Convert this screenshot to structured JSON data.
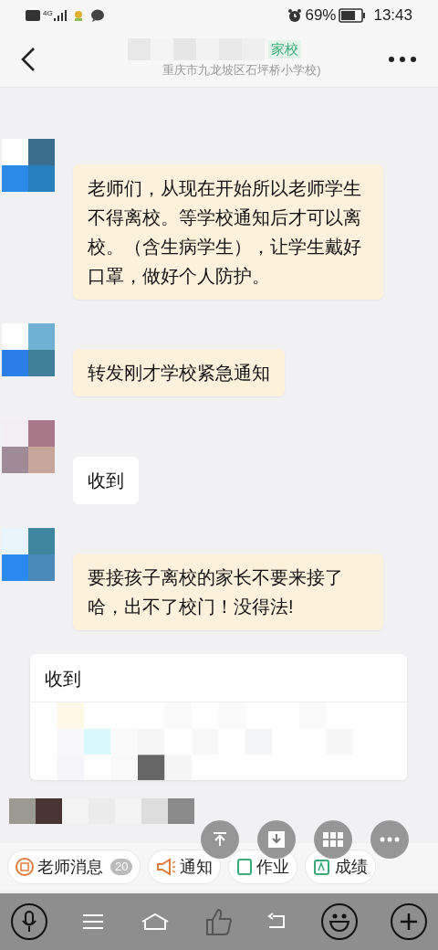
{
  "status_bar": {
    "network": "4G",
    "battery": "69%",
    "time": "13:43"
  },
  "header": {
    "tag": "家校",
    "subtitle": "重庆市九龙坡区石坪桥小学校)"
  },
  "messages": [
    {
      "kind": "teacher",
      "text": "老师们，从现在开始所以老师学生不得离校。等学校通知后才可以离校。（含生病学生），让学生戴好口罩，做好个人防护。"
    },
    {
      "kind": "teacher",
      "text": "转发刚才学校紧急通知"
    },
    {
      "kind": "parent",
      "text": "收到"
    },
    {
      "kind": "teacher",
      "text": "要接孩子离校的家长不要来接了哈，出不了校门！没得法!"
    }
  ],
  "card": {
    "title": "收到"
  },
  "shortcuts": [
    {
      "kind": "teacher",
      "label": "老师消息",
      "count": "20"
    },
    {
      "kind": "notice",
      "label": "通知"
    },
    {
      "kind": "homework",
      "label": "作业"
    },
    {
      "kind": "grades",
      "label": "成绩"
    }
  ]
}
